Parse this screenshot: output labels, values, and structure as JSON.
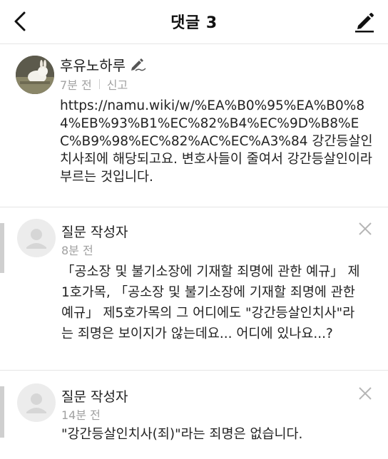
{
  "header": {
    "title": "댓글 3",
    "back_icon": "chevron-left-icon",
    "write_icon": "pencil-icon"
  },
  "main_comment": {
    "author": "후유노하루",
    "author_badge_icon": "pencil-signature-icon",
    "time": "7분 전",
    "report_label": "신고",
    "text": "https://namu.wiki/w/%EA%B0%95%EA%B0%84%EB%93%B1%EC%82%B4%EC%9D%B8%EC%B9%98%EC%82%AC%EC%A3%84 강간등살인치사죄에 해당되고요. 변호사들이 줄여서 강간등살인이라 부르는 것입니다."
  },
  "replies": [
    {
      "author": "질문 작성자",
      "time": "8분 전",
      "text": "「공소장 및 불기소장에 기재할 죄명에 관한 예규」 제1호가목, 「공소장 및 불기소장에 기재할 죄명에 관한 예규」 제5호가목의 그 어디에도 \"강간등살인치사\"라는 죄명은 보이지가 않는데요... 어디에 있나요...?"
    },
    {
      "author": "질문 작성자",
      "time": "14분 전",
      "text": "\"강간등살인치사(죄)\"라는 죄명은 없습니다."
    }
  ],
  "colors": {
    "accent_text": "#1e1e1e",
    "meta_gray": "#a2a2a2",
    "reply_bar": "#cfcfcf"
  }
}
